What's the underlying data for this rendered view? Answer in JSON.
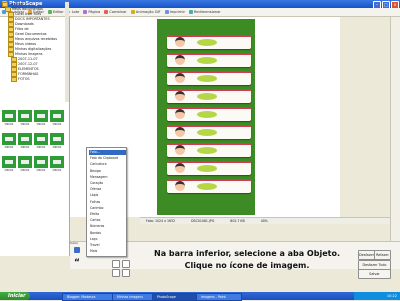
{
  "window": {
    "title": "PhotoScape"
  },
  "tabs": [
    {
      "label": "Visualizar",
      "color": "#4b9de0"
    },
    {
      "label": "Editor",
      "color": "#e0a040"
    },
    {
      "label": "Editor em Lote",
      "color": "#58b858"
    },
    {
      "label": "Página",
      "color": "#b070d0"
    },
    {
      "label": "Combinar",
      "color": "#e06060"
    },
    {
      "label": "Animação GIF",
      "color": "#d0b020"
    },
    {
      "label": "Imprimir",
      "color": "#7090e0"
    },
    {
      "label": "Redimensionar",
      "color": "#40b0b0"
    }
  ],
  "tree": [
    {
      "label": "Desktop",
      "indent": 0
    },
    {
      "label": "Meus documentos",
      "indent": 1
    },
    {
      "label": "Corel User Files",
      "indent": 2
    },
    {
      "label": "DOCS IMPORTANTES",
      "indent": 2
    },
    {
      "label": "Downloads",
      "indent": 2
    },
    {
      "label": "Filtro de",
      "indent": 2
    },
    {
      "label": "Gerei Documentos",
      "indent": 2
    },
    {
      "label": "Meus arquivos recebidos",
      "indent": 2
    },
    {
      "label": "Meus vídeos",
      "indent": 2
    },
    {
      "label": "Minhas digitalizações",
      "indent": 2
    },
    {
      "label": "Minhas imagens",
      "indent": 2
    },
    {
      "label": "2007-11-07",
      "indent": 3
    },
    {
      "label": "2007-12-07",
      "indent": 3
    },
    {
      "label": "ELEMENTOS",
      "indent": 3
    },
    {
      "label": "FORMINHAS",
      "indent": 3
    },
    {
      "label": "FOTOS",
      "indent": 3
    }
  ],
  "thumbs": [
    "DSC01",
    "DSC01",
    "DSC01",
    "DSC01",
    "DSC01",
    "DSC01",
    "DSC01",
    "DSC01",
    "DSC01",
    "DSC01",
    "DSC01",
    "DSC01"
  ],
  "status": {
    "size": "Foto: 1024 x 1632",
    "filename": "DSC01081.JPG",
    "filesize": "802.7 KB",
    "zoom": "40%"
  },
  "menu": [
    "Foto...",
    "Foto do Clipboard",
    "Caricatura",
    "Bexiga",
    "Mensagem",
    "Coração",
    "Ofensa",
    "Lápis",
    "Folhas",
    "Carimbo",
    "Efeito",
    "Cartas",
    "Números",
    "Bordas",
    "Laço",
    "Travel",
    "Mais"
  ],
  "menu_selected": 0,
  "bottom": {
    "tab_label": "Início",
    "quote": "“",
    "buttons": [
      "Desfazer",
      "Refazer",
      "Desfazer Tudo",
      "Salvar"
    ]
  },
  "instruction": {
    "line1": "Na barra inferior, selecione a aba Objeto.",
    "line2": "Clique no ícone de imagem."
  },
  "taskbar": {
    "start": "Iniciar",
    "tasks": [
      "Blogger: Modesca",
      "Minhas imagens",
      "PhotoScape",
      "Imagens - Paint"
    ],
    "time": "10:22"
  }
}
